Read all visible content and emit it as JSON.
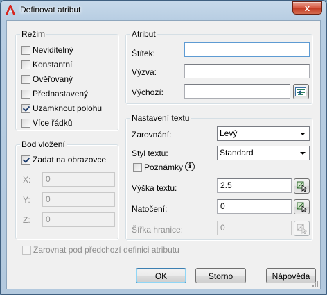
{
  "window": {
    "title": "Definovat atribut",
    "close_glyph": "x"
  },
  "mode": {
    "legend": "Režim",
    "items": [
      {
        "label": "Neviditelný",
        "checked": false
      },
      {
        "label": "Konstantní",
        "checked": false
      },
      {
        "label": "Ověřovaný",
        "checked": false
      },
      {
        "label": "Přednastavený",
        "checked": false
      },
      {
        "label": "Uzamknout polohu",
        "checked": true
      },
      {
        "label": "Více řádků",
        "checked": false
      }
    ]
  },
  "attribute": {
    "legend": "Atribut",
    "tag_label": "Štítek:",
    "tag_value": "",
    "prompt_label": "Výzva:",
    "prompt_value": "",
    "default_label": "Výchozí:",
    "default_value": ""
  },
  "insertion": {
    "legend": "Bod vložení",
    "specify_on_screen": "Zadat na obrazovce",
    "specify_checked": true,
    "x_label": "X:",
    "x_value": "0",
    "y_label": "Y:",
    "y_value": "0",
    "z_label": "Z:",
    "z_value": "0"
  },
  "text_settings": {
    "legend": "Nastavení textu",
    "justification_label": "Zarovnání:",
    "justification_value": "Levý",
    "style_label": "Styl textu:",
    "style_value": "Standard",
    "annotative_label": "Poznámky",
    "annotative_checked": false,
    "info_glyph": "i",
    "height_label": "Výška textu:",
    "height_value": "2.5",
    "rotation_label": "Natočení:",
    "rotation_value": "0",
    "boundary_label": "Šířka hranice:",
    "boundary_value": "0"
  },
  "align_below": {
    "label": "Zarovnat pod předchozí definici atributu",
    "checked": false
  },
  "buttons": {
    "ok": "OK",
    "cancel": "Storno",
    "help": "Nápověda"
  },
  "colors": {
    "accent": "#3c7fb1",
    "close_button": "#c23a22",
    "disabled_text": "#8d8d8d",
    "checkmark": "#1d3d6e"
  },
  "icons": {
    "app": "autocad-logo-icon",
    "close": "close-icon",
    "insert_field": "insert-field-icon",
    "pick": "pick-point-icon",
    "info": "info-icon"
  }
}
